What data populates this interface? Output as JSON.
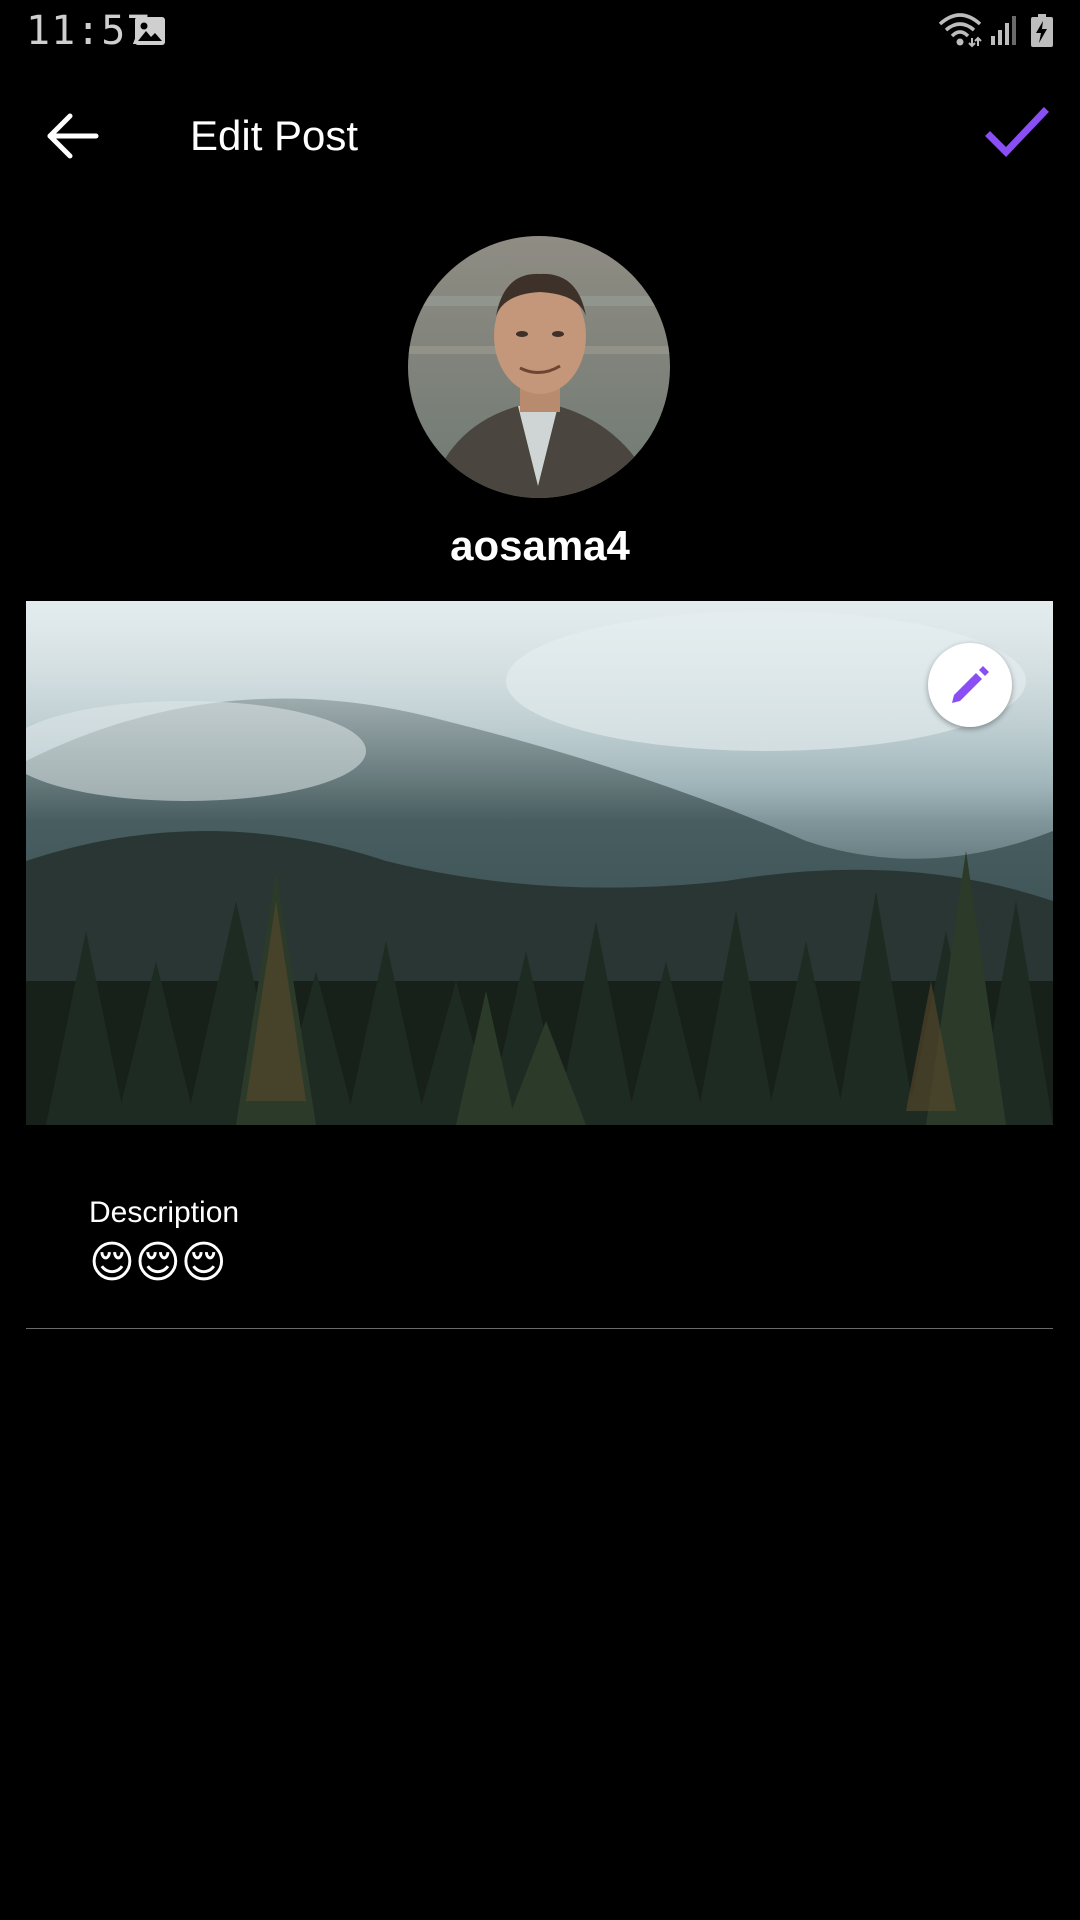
{
  "status_bar": {
    "time": "11:57",
    "icons": [
      "gallery-icon",
      "wifi-icon",
      "cell-signal-icon",
      "battery-charging-icon"
    ]
  },
  "app_bar": {
    "title": "Edit Post",
    "back_icon": "arrow-back-icon",
    "confirm_icon": "checkmark-icon"
  },
  "profile": {
    "username": "aosama4"
  },
  "post": {
    "image_subject": "misty forested mountain valley",
    "edit_icon": "pencil-icon"
  },
  "description": {
    "label": "Description",
    "value": "😌😌😌"
  },
  "colors": {
    "background": "#000000",
    "accent": "#8a4ef5",
    "text": "#ffffff",
    "divider": "#6a6a6a"
  }
}
